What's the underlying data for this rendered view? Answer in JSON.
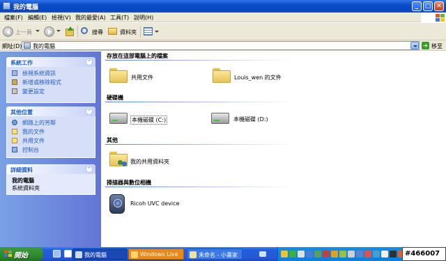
{
  "window": {
    "title": "我的電腦"
  },
  "menu": [
    "檔案(F)",
    "編輯(E)",
    "檢視(V)",
    "我的最愛(A)",
    "工具(T)",
    "說明(H)"
  ],
  "toolbar": {
    "back": "上一頁",
    "search": "搜尋",
    "folders": "資料夾"
  },
  "address": {
    "label": "網址(D)",
    "value": "我的電腦",
    "go": "移至"
  },
  "tasks_panel": {
    "title": "系統工作",
    "items": [
      "檢視系統資訊",
      "新增或移除程式",
      "變更設定"
    ]
  },
  "places_panel": {
    "title": "其他位置",
    "items": [
      "網路上的芳鄰",
      "我的文件",
      "共用文件",
      "控制台"
    ]
  },
  "details_panel": {
    "title": "詳細資料",
    "name": "我的電腦",
    "type": "系統資料夾"
  },
  "groups": {
    "stored": {
      "title": "存放在這部電腦上的檔案",
      "items": [
        "共用文件",
        "Louis_wen 的文件"
      ]
    },
    "drives": {
      "title": "硬碟機",
      "items": [
        "本機磁碟 (C:)",
        "本機磁碟 (D:)"
      ]
    },
    "other": {
      "title": "其他",
      "items": [
        "我的共用資料夾"
      ]
    },
    "scanners": {
      "title": "掃描器與數位相機",
      "items": [
        "Ricoh UVC device"
      ]
    }
  },
  "taskbar": {
    "start": "開始",
    "tasks": [
      "我的電腦",
      "Windows Live",
      "未命名 - 小畫家"
    ],
    "tag": "#466007"
  },
  "colors": {
    "titlebar": "#0a4cc8",
    "leftpane": "#6f8fe0",
    "taskbar": "#245edb",
    "start": "#2f8a2f"
  }
}
